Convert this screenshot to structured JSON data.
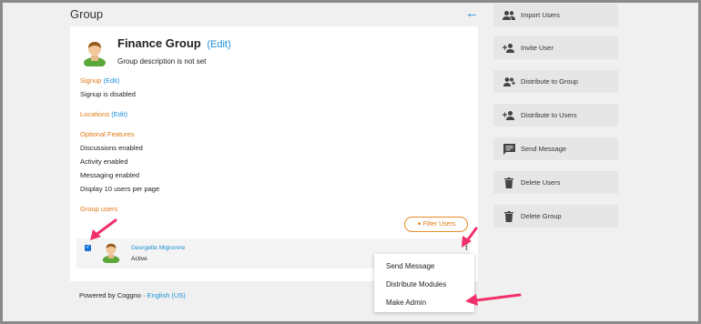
{
  "page": {
    "title": "Group"
  },
  "group": {
    "name": "Finance Group",
    "edit_label": "(Edit)",
    "description": "Group description is not set"
  },
  "signup": {
    "label": "Signup",
    "edit_label": "(Edit)",
    "text": "Signup is disabled"
  },
  "locations": {
    "label": "Locations",
    "edit_label": "(Edit)"
  },
  "optional_features": {
    "label": "Optional Features",
    "items": [
      "Discussions enabled",
      "Activity enabled",
      "Messaging enabled",
      "Display 10 users per page"
    ]
  },
  "group_users": {
    "label": "Group users",
    "filter_label": "Filter Users",
    "rows": [
      {
        "name": "Georgette Mignonne",
        "status": "Active",
        "checked": true
      }
    ]
  },
  "context_menu": {
    "items": [
      "Send Message",
      "Distribute Modules",
      "Make Admin"
    ]
  },
  "footer": {
    "powered": "Powered by Coggno · ",
    "language": "English (US)"
  },
  "sidebar": {
    "buttons": [
      {
        "label": "Import Users",
        "icon": "users-group-icon"
      },
      {
        "label": "Invite User",
        "icon": "add-user-icon"
      },
      {
        "label": "Distribute to Group",
        "icon": "group-add-icon"
      },
      {
        "label": "Distribute to Users",
        "icon": "add-user-icon"
      },
      {
        "label": "Send Message",
        "icon": "message-icon"
      },
      {
        "label": "Delete Users",
        "icon": "trash-icon"
      },
      {
        "label": "Delete Group",
        "icon": "trash-icon"
      }
    ]
  },
  "colors": {
    "accent_blue": "#1a8fd6",
    "accent_orange": "#e07a16",
    "annotation_pink": "#f0306a"
  }
}
